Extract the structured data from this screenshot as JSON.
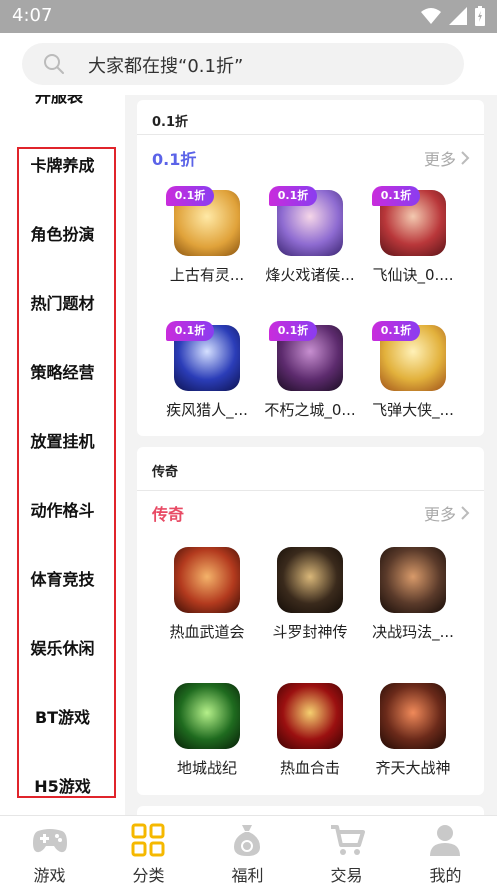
{
  "status": {
    "time": "4:07"
  },
  "search": {
    "placeholder": "大家都在搜“0.1折”"
  },
  "sidebar": {
    "cut_item": "开服表",
    "items": [
      {
        "label": "卡牌养成"
      },
      {
        "label": "角色扮演"
      },
      {
        "label": "热门题材"
      },
      {
        "label": "策略经营"
      },
      {
        "label": "放置挂机"
      },
      {
        "label": "动作格斗"
      },
      {
        "label": "体育竞技"
      },
      {
        "label": "娱乐休闲"
      },
      {
        "label": "BT游戏"
      },
      {
        "label": "H5游戏"
      }
    ]
  },
  "sections": [
    {
      "header": "0.1折",
      "title": "0.1折",
      "title_color": "#5b63e8",
      "more": "更多",
      "badge": "0.1折",
      "games": [
        {
          "name": "上古有灵...",
          "icon": "golden-fox-game-icon",
          "color": "#e0a23a"
        },
        {
          "name": "烽火戏诸侯...",
          "icon": "anime-girl-game-icon",
          "color": "#8e6bd1"
        },
        {
          "name": "飞仙诀_0....",
          "icon": "couple-game-icon",
          "color": "#b9373a"
        },
        {
          "name": "疾风猎人_...",
          "icon": "blue-dragon-game-icon",
          "color": "#2b3db8"
        },
        {
          "name": "不朽之城_0...",
          "icon": "warrior-game-icon",
          "color": "#5d2b6e"
        },
        {
          "name": "飞弹大侠_...",
          "icon": "archer-game-icon",
          "color": "#e2b13c"
        }
      ]
    },
    {
      "header": "传奇",
      "title": "传奇",
      "title_color": "#e84a64",
      "more": "更多",
      "games": [
        {
          "name": "热血武道会",
          "icon": "wu-character-game-icon",
          "color": "#b33a1e"
        },
        {
          "name": "斗罗封神传",
          "icon": "sword-game-icon",
          "color": "#3a2a1c"
        },
        {
          "name": "决战玛法_...",
          "icon": "mafa-game-icon",
          "color": "#5a3a2a"
        },
        {
          "name": "地城战纪",
          "icon": "skull-game-icon",
          "color": "#1f6b1f"
        },
        {
          "name": "热血合击",
          "icon": "dragon-character-game-icon",
          "color": "#9b1010"
        },
        {
          "name": "齐天大战神",
          "icon": "monkey-king-game-icon",
          "color": "#6b2a1a"
        }
      ]
    }
  ],
  "bottom_nav": [
    {
      "label": "游戏",
      "icon": "gamepad-icon",
      "active": false
    },
    {
      "label": "分类",
      "icon": "category-grid-icon",
      "active": true
    },
    {
      "label": "福利",
      "icon": "money-bag-icon",
      "active": false
    },
    {
      "label": "交易",
      "icon": "cart-icon",
      "active": false
    },
    {
      "label": "我的",
      "icon": "user-icon",
      "active": false
    }
  ],
  "colors": {
    "active_nav": "#f5b800",
    "inactive_nav": "#c9c9c9",
    "sidebar_frame": "#e0242b"
  }
}
